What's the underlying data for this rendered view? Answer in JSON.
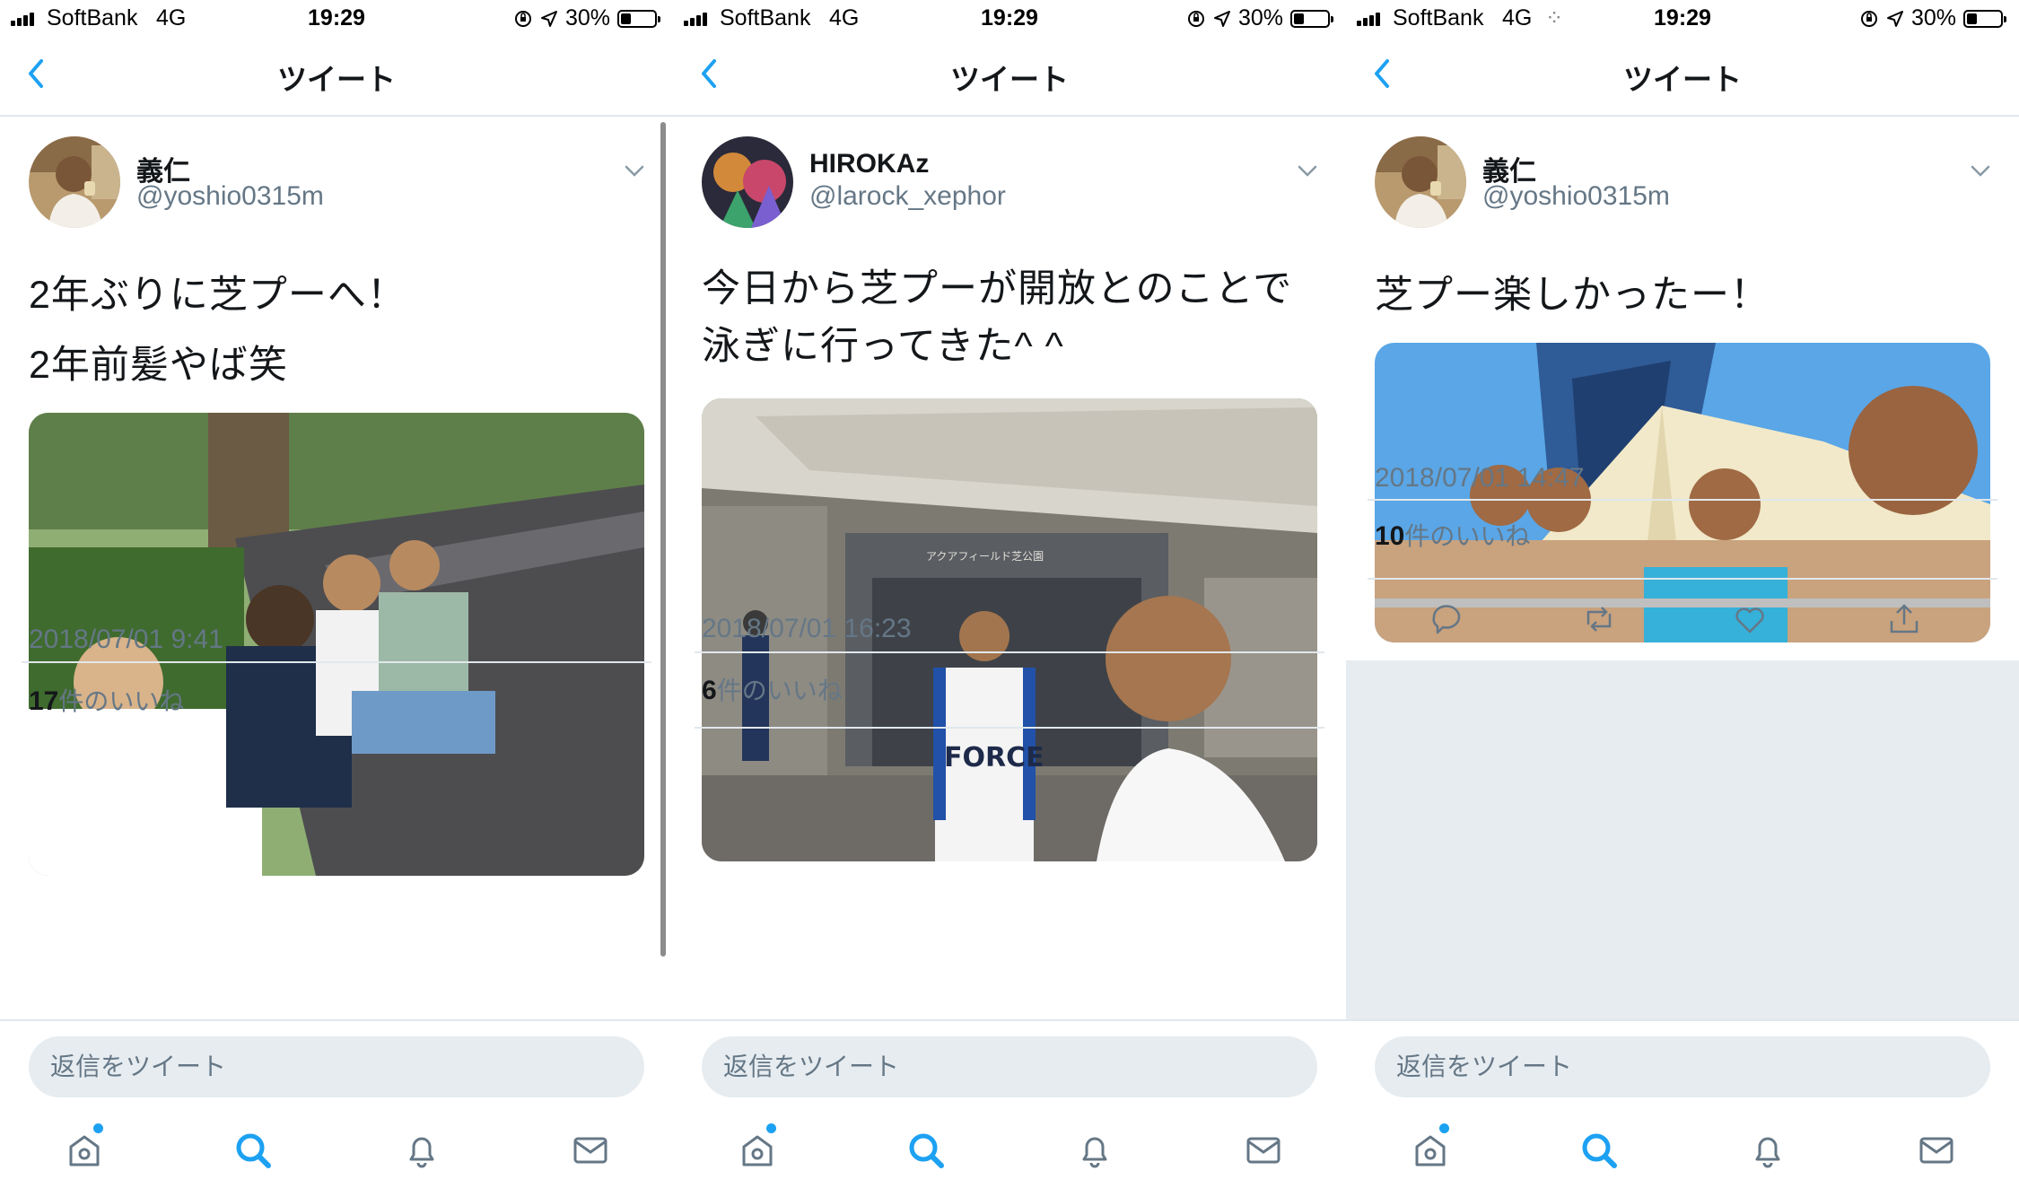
{
  "status_bar": {
    "carrier": "SoftBank",
    "network": "4G",
    "time": "19:29",
    "battery": "30%",
    "loading_glyph": "⁘"
  },
  "nav": {
    "title": "ツイート"
  },
  "tweets": [
    {
      "display_name": "義仁",
      "handle": "@yoshio0315m",
      "lines": [
        "2年ぶりに芝プーへ！",
        "2年前髪やば笑"
      ],
      "photo_alt": "Group selfie of four men sitting on a curb in a park",
      "timestamp": "2018/07/01 9:41",
      "likes_count": "17",
      "likes_suffix": "件のいいね"
    },
    {
      "display_name": "HIROKAz",
      "handle": "@larock_xephor",
      "lines": [
        "今日から芝プーが開放とのことで",
        "泳ぎに行ってきた^ ^"
      ],
      "photo_alt": "Selfie of two men in front of a pool building entrance",
      "photo_signs": {
        "shirt": "FORCE",
        "building": "アクアフィールド芝公園"
      },
      "timestamp": "2018/07/01 16:23",
      "likes_count": "6",
      "likes_suffix": "件のいいね"
    },
    {
      "display_name": "義仁",
      "handle": "@yoshio0315m",
      "lines": [
        "芝プー楽しかったー！"
      ],
      "photo_alt": "Selfie of four men at a pool under a tower",
      "timestamp": "2018/07/01 14:47",
      "likes_count": "10",
      "likes_suffix": "件のいいね"
    }
  ],
  "reply": {
    "placeholder": "返信をツイート"
  },
  "tabs": [
    "home-icon",
    "search-icon",
    "notifications-icon",
    "messages-icon"
  ],
  "colors": {
    "accent": "#1da1f2",
    "text": "#14171a",
    "secondary": "#657786",
    "border": "#e1e8ed",
    "input_bg": "#e6ecf0"
  }
}
